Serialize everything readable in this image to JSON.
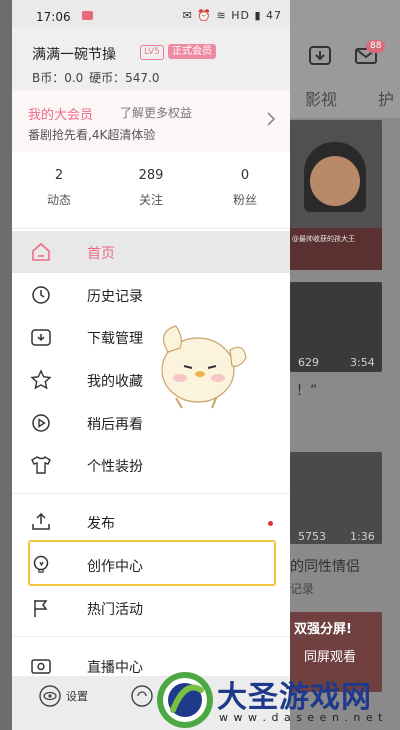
{
  "status": {
    "time": "17:06",
    "system": "✉ ⏰ ≋ HD ▮ 47"
  },
  "profile": {
    "name": "满满一碗节操",
    "level": "LV5",
    "vip_badge": "正式会员",
    "coins": "B币：0.0   硬币：547.0"
  },
  "vip_card": {
    "title": "我的大会员",
    "link": "了解更多权益",
    "desc": "番剧抢先看,4K超清体验"
  },
  "stats": [
    {
      "value": "2",
      "label": "动态"
    },
    {
      "value": "289",
      "label": "关注"
    },
    {
      "value": "0",
      "label": "粉丝"
    }
  ],
  "menu": [
    {
      "label": "首页",
      "icon": "home-icon"
    },
    {
      "label": "历史记录",
      "icon": "history-icon"
    },
    {
      "label": "下载管理",
      "icon": "download-icon"
    },
    {
      "label": "我的收藏",
      "icon": "star-icon"
    },
    {
      "label": "稍后再看",
      "icon": "watch-later-icon"
    },
    {
      "label": "个性装扮",
      "icon": "shirt-icon"
    },
    {
      "label": "发布",
      "icon": "upload-icon"
    },
    {
      "label": "创作中心",
      "icon": "lightbulb-icon"
    },
    {
      "label": "热门活动",
      "icon": "flag-icon"
    },
    {
      "label": "直播中心",
      "icon": "live-icon"
    }
  ],
  "bottom": {
    "settings": "设置"
  },
  "background": {
    "tab1": "影视",
    "tab2": "护",
    "badge": "88",
    "card1_caption": "@最帅收获的孩大王",
    "card2_views": "629",
    "card2_duration": "3:54",
    "card2_text": "！”",
    "card3_views": "5753",
    "card3_duration": "1:36",
    "card3_text": "的同性情侣",
    "card3_text2": "记录",
    "card4_text": "双强分屏!",
    "card4_text2": "同屏观看"
  },
  "watermark": {
    "title": "大圣游戏网",
    "url": "w w w . d a s e e n . n e t"
  },
  "colors": {
    "accent": "#f06a86",
    "highlight_box": "#f5c542"
  }
}
